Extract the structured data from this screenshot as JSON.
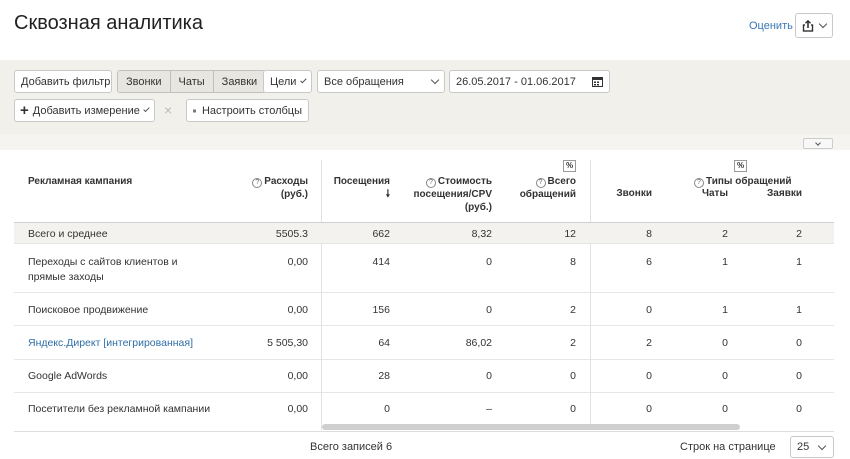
{
  "header": {
    "title": "Сквозная аналитика",
    "rate_label": "Оценить"
  },
  "toolbar": {
    "add_filter": "Добавить фильтр",
    "segments": [
      "Звонки",
      "Чаты",
      "Заявки"
    ],
    "goals": "Цели",
    "requests": "Все обращения",
    "date_range": "26.05.2017 - 01.06.2017",
    "add_dimension": "Добавить измерение",
    "configure_columns": "Настроить столбцы"
  },
  "table": {
    "headers": {
      "campaign": "Рекламная кампания",
      "expenses": [
        "Расходы",
        "(руб.)"
      ],
      "visits": "Посещения",
      "cost": [
        "Стоимость",
        "посещения/CPV",
        "(руб.)"
      ],
      "total_requests": [
        "Всего",
        "обращений"
      ],
      "calls": "Звонки",
      "request_types": "Типы обращений",
      "chats": "Чаты",
      "applications": "Заявки",
      "pct": "%"
    },
    "total_row": {
      "name": "Всего и среднее",
      "expenses": "5505.3",
      "visits": "662",
      "cost": "8,32",
      "total": "12",
      "calls": "8",
      "chats": "2",
      "apps": "2"
    },
    "rows": [
      {
        "name": "Переходы с сайтов клиентов и",
        "name2": "прямые заходы",
        "expenses": "0,00",
        "visits": "414",
        "cost": "0",
        "total": "8",
        "calls": "6",
        "chats": "1",
        "apps": "1"
      },
      {
        "name": "Поисковое продвижение",
        "expenses": "0,00",
        "visits": "156",
        "cost": "0",
        "total": "2",
        "calls": "0",
        "chats": "1",
        "apps": "1"
      },
      {
        "name": "Яндекс.Директ [интегрированная]",
        "expenses": "5 505,30",
        "visits": "64",
        "cost": "86,02",
        "total": "2",
        "calls": "2",
        "chats": "0",
        "apps": "0"
      },
      {
        "name": "Google AdWords",
        "expenses": "0,00",
        "visits": "28",
        "cost": "0",
        "total": "0",
        "calls": "0",
        "chats": "0",
        "apps": "0"
      },
      {
        "name": "Посетители без рекламной кампании",
        "expenses": "0,00",
        "visits": "0",
        "cost": "–",
        "total": "0",
        "calls": "0",
        "chats": "0",
        "apps": "0"
      }
    ]
  },
  "footer": {
    "total_records": "Всего записей 6",
    "rows_per_page_label": "Строк на странице",
    "rows_per_page": "25"
  },
  "colors": {
    "link": "#2f6fa8",
    "toolbar_bg": "#f2f0ea"
  }
}
